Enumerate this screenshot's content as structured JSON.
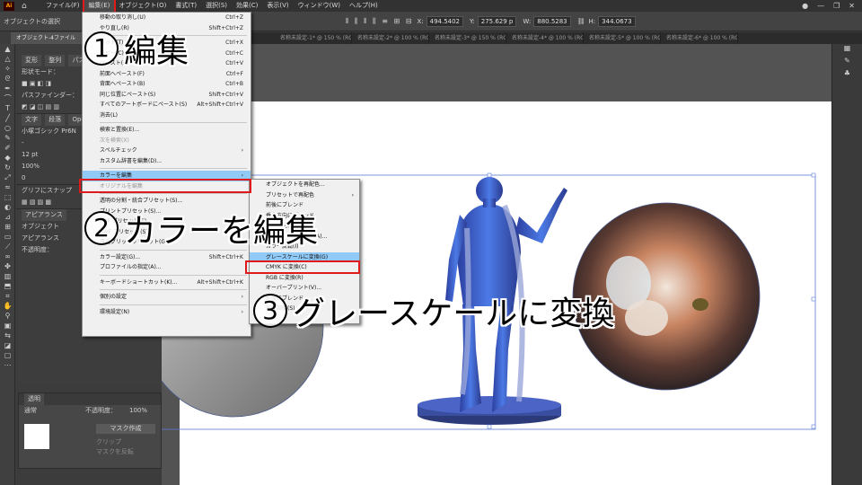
{
  "menubar": {
    "logo": "Ai",
    "items": [
      "ファイル(F)",
      "編集(E)",
      "オブジェクト(O)",
      "書式(T)",
      "選択(S)",
      "効果(C)",
      "表示(V)",
      "ウィンドウ(W)",
      "ヘルプ(H)"
    ],
    "active_index": 1
  },
  "controlbar": {
    "selection_label": "オブジェクトの選択",
    "x_label": "X:",
    "x_value": "494.5402",
    "y_label": "Y:",
    "y_value": "275.629 p",
    "w_label": "W:",
    "w_value": "880.5283",
    "h_label": "H:",
    "h_value": "344.0673"
  },
  "tabs": [
    "オブジェクト-4ファイル",
    "名称未設定-1* @ 150 % (RGB/プレビ...",
    "名称未設定-2* @ 100 % (RGB/プレビ...",
    "名称未設定-3* @ 150 % (RGB/プレビ...",
    "名称未設定-4* @ 100 % (RGB/プレビ...",
    "名称未設定-5* @ 100 % (RGB/プレビ...",
    "名称未設定-6* @ 100 % (RGB/プレビ..."
  ],
  "leftpanel": {
    "shape_label": "形状モード：",
    "tab1": "変形",
    "tab2": "整列",
    "tab3": "パス",
    "pathfinder_label": "パスファインダー：",
    "text_tab": "文字",
    "para_tab": "段落",
    "opentype_tab": "Ope",
    "font": "小塚ゴシック Pr6N",
    "size": "12 pt",
    "scale": "100%",
    "tracking": "0",
    "glyph_label": "グリフにスナップ",
    "appearance_tab": "アピアランス",
    "appearance_obj": "オブジェクト",
    "appearance_sub": "アピアランス",
    "opacity": "不透明度："
  },
  "transpanel": {
    "title": "透明",
    "mode": "通常",
    "opacity_label": "不透明度：",
    "opacity_value": "100%",
    "mask_button": "マスク作成",
    "clip_label": "クリップ",
    "invert_label": "マスクを反転"
  },
  "editmenu": {
    "items": [
      {
        "label": "移動の取り消し(U)",
        "sc": "Ctrl+Z",
        "disabled": false
      },
      {
        "label": "やり直し(R)",
        "sc": "Shift+Ctrl+Z",
        "disabled": false
      },
      {
        "sep": true
      },
      {
        "label": "カット(T)",
        "sc": "Ctrl+X",
        "disabled": false
      },
      {
        "label": "コピー(C)",
        "sc": "Ctrl+C",
        "disabled": false
      },
      {
        "label": "ペースト(P)",
        "sc": "Ctrl+V",
        "disabled": false
      },
      {
        "label": "前面へペースト(F)",
        "sc": "Ctrl+F",
        "disabled": false
      },
      {
        "label": "背面へペースト(B)",
        "sc": "Ctrl+B",
        "disabled": false
      },
      {
        "label": "同じ位置にペースト(S)",
        "sc": "Shift+Ctrl+V",
        "disabled": false
      },
      {
        "label": "すべてのアートボードにペースト(S)",
        "sc": "Alt+Shift+Ctrl+V",
        "disabled": false
      },
      {
        "label": "消去(L)",
        "sc": "",
        "disabled": false
      },
      {
        "sep": true
      },
      {
        "label": "検索と置換(E)...",
        "sc": "",
        "disabled": false
      },
      {
        "label": "次を検索(X)",
        "sc": "",
        "disabled": true
      },
      {
        "label": "スペルチェック",
        "sc": "›",
        "disabled": false
      },
      {
        "label": "カスタム辞書を編集(D)...",
        "sc": "",
        "disabled": false
      },
      {
        "sep": true
      },
      {
        "label": "カラーを編集",
        "sc": "›",
        "disabled": false,
        "hl": true
      },
      {
        "label": "オリジナルを編集",
        "sc": "",
        "disabled": true
      },
      {
        "sep": true
      },
      {
        "label": "透明の分割・統合プリセット(S)...",
        "sc": "",
        "disabled": false
      },
      {
        "label": "プリントプリセット(S)...",
        "sc": "",
        "disabled": false
      },
      {
        "label": "PDF プリセット(S)...",
        "sc": "",
        "disabled": false
      },
      {
        "label": "SWF プリセット(S)...",
        "sc": "",
        "disabled": false
      },
      {
        "label": "遠近グリッドプリセット(G)...",
        "sc": "",
        "disabled": false
      },
      {
        "sep": true
      },
      {
        "label": "カラー設定(G)...",
        "sc": "Shift+Ctrl+K",
        "disabled": false
      },
      {
        "label": "プロファイルの指定(A)...",
        "sc": "",
        "disabled": false
      },
      {
        "sep": true
      },
      {
        "label": "キーボードショートカット(K)...",
        "sc": "Alt+Shift+Ctrl+K",
        "disabled": false
      },
      {
        "sep": true
      },
      {
        "label": "個別の設定",
        "sc": "›",
        "disabled": false
      },
      {
        "sep": true
      },
      {
        "label": "環境設定(N)",
        "sc": "›",
        "disabled": false
      }
    ]
  },
  "submenu": {
    "items": [
      {
        "label": "オブジェクトを再配色...",
        "sc": ""
      },
      {
        "label": "プリセットで再配色",
        "sc": "›"
      },
      {
        "label": "前後にブレンド",
        "sc": ""
      },
      {
        "label": "垂直方向にブレンド",
        "sc": ""
      },
      {
        "label": "水平方向にブレンド",
        "sc": ""
      },
      {
        "label": "カラーバランス調整(A)...",
        "sc": ""
      },
      {
        "label": "カラー反転(I)",
        "sc": ""
      },
      {
        "label": "グレースケールに変換(G)",
        "sc": "",
        "hl": true
      },
      {
        "label": "CMYK に変換(C)",
        "sc": ""
      },
      {
        "label": "RGB に変換(R)",
        "sc": ""
      },
      {
        "label": "オーバープリント(V)...",
        "sc": ""
      },
      {
        "label": "前後にブレンド",
        "sc": ""
      },
      {
        "label": "彩度調整(S)...",
        "sc": ""
      }
    ]
  },
  "annotations": {
    "a1_num": "1",
    "a1_text": "編集",
    "a2_num": "2",
    "a2_text": "カラーを編集",
    "a3_num": "3",
    "a3_text": "グレースケールに変換"
  },
  "colors": {
    "highlight": "#e01a1a",
    "menu_hl": "#91c9f7",
    "figure": "#3a5bd8"
  }
}
